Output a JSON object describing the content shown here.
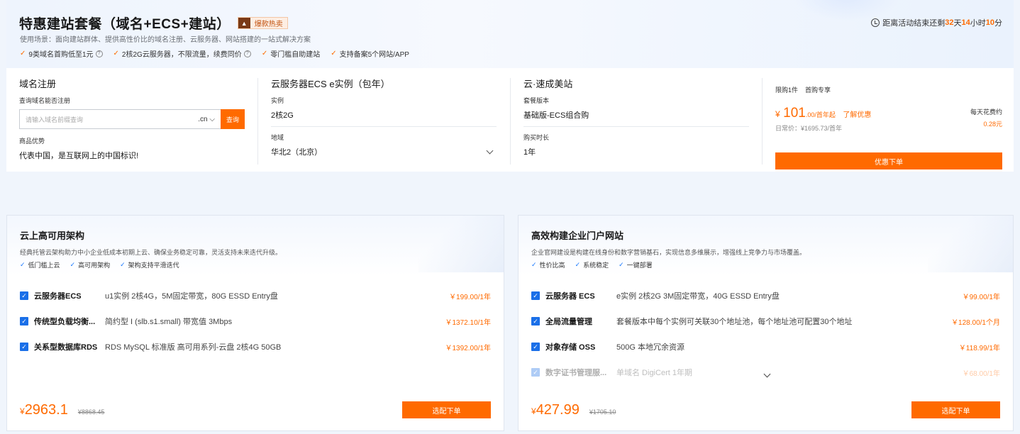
{
  "hero": {
    "title": "特惠建站套餐（域名+ECS+建站）",
    "badge": "爆款热卖",
    "badge_icon": "flame-icon",
    "description": "使用场景：面向建站群体、提供高性价比的域名注册、云服务器、网站搭建的一站式解决方案",
    "features": [
      {
        "text": "9类域名首购低至1元",
        "help": true
      },
      {
        "text": "2核2G云服务器，不限流量，续费同价",
        "help": true
      },
      {
        "text": "零门槛自助建站",
        "help": false
      },
      {
        "text": "支持备案5个网站/APP",
        "help": false
      }
    ],
    "countdown": {
      "prefix": "距离活动结束还剩",
      "days": "32",
      "days_unit": "天",
      "hours": "14",
      "hours_unit": "小时",
      "minutes": "10",
      "minutes_unit": "分"
    }
  },
  "config": {
    "domain": {
      "title": "域名注册",
      "search_label": "查询域名能否注册",
      "search_placeholder": "请输入域名前缀查询",
      "suffix": ".cn",
      "search_button": "查询",
      "advantage_label": "商品优势",
      "advantage_text": "代表中国，是互联网上的中国标识!"
    },
    "ecs": {
      "title": "云服务器ECS e实例（包年）",
      "instance_label": "实例",
      "instance_value": "2核2G",
      "region_label": "地域",
      "region_value": "华北2（北京）"
    },
    "site": {
      "title": "云·速成美站",
      "version_label": "套餐版本",
      "version_value": "基础版-ECS组合购",
      "duration_label": "购买时长",
      "duration_value": "1年"
    },
    "order": {
      "tags": [
        "限购1件",
        "首购专享"
      ],
      "yen": "¥",
      "price_int": "101",
      "price_dec": ".00",
      "price_unit": "/首年起",
      "discount_link": "了解优惠",
      "original": "日常价：¥1695.73/首年",
      "daily_label": "每天花费约",
      "daily_value": "0.28元",
      "button": "优惠下单"
    }
  },
  "solutions": [
    {
      "title": "云上高可用架构",
      "description": "经典托管云架构助力中小企业低成本初期上云、确保业务稳定可靠，灵活支持未来迭代升级。",
      "features": [
        "低门槛上云",
        "高可用架构",
        "架构支持平滑迭代"
      ],
      "items": [
        {
          "name": "云服务器ECS",
          "spec": "u1实例 2核4G，5M固定带宽，80G ESSD Entry盘",
          "price": "￥199.00/1年"
        },
        {
          "name": "传统型负载均衡...",
          "spec": "简约型 I (slb.s1.small) 带宽值 3Mbps",
          "price": "￥1372.10/1年"
        },
        {
          "name": "关系型数据库RDS",
          "spec": "RDS MySQL 标准版 高可用系列-云盘 2核4G 50GB",
          "price": "￥1392.00/1年"
        }
      ],
      "yen": "¥",
      "total": "2963.1",
      "original_total": "¥8868.45",
      "button": "选配下单"
    },
    {
      "title": "高效构建企业门户网站",
      "description": "企业官网建设是构建在线身份和数字营销基石，实现信息多维展示，增强线上竞争力与市场覆盖。",
      "features": [
        "性价比高",
        "系统稳定",
        "一键部署"
      ],
      "items": [
        {
          "name": "云服务器 ECS",
          "spec": "e实例 2核2G 3M固定带宽，40G ESSD Entry盘",
          "price": "￥99.00/1年"
        },
        {
          "name": "全局流量管理",
          "spec": "套餐版本中每个实例可关联30个地址池，每个地址池可配置30个地址",
          "price": "￥128.00/1个月"
        },
        {
          "name": "对象存储 OSS",
          "spec": "500G 本地冗余资源",
          "price": "￥118.99/1年"
        },
        {
          "name": "数字证书管理服...",
          "spec": "单域名 DigiCert 1年期",
          "price": "￥68.00/1年"
        }
      ],
      "yen": "¥",
      "total": "427.99",
      "original_total": "¥1705.10",
      "button": "选配下单"
    }
  ]
}
